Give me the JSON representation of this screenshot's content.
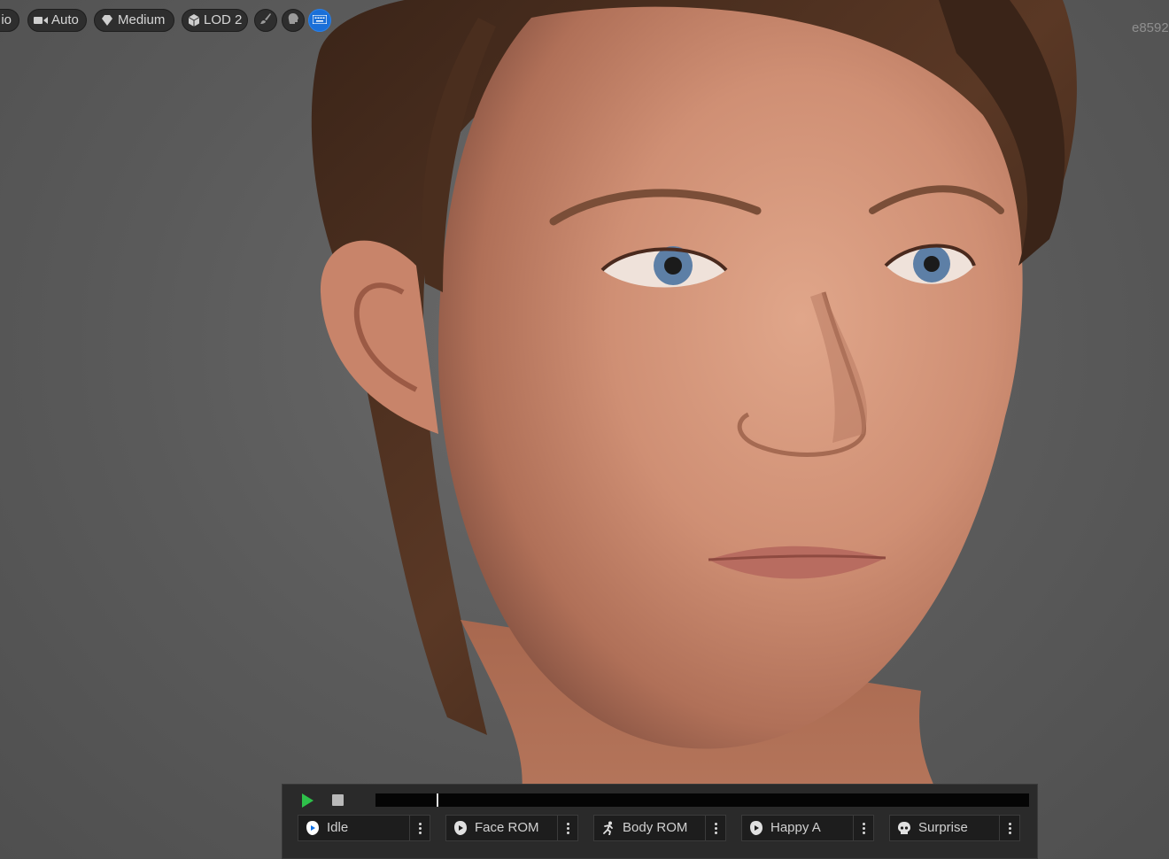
{
  "toolbar": {
    "cut_label": "io",
    "auto_label": "Auto",
    "medium_label": "Medium",
    "lod_label": "LOD 2",
    "icons": [
      "camera-icon",
      "diamond-icon",
      "cube-icon",
      "brush-icon",
      "head-icon",
      "keyboard-icon"
    ]
  },
  "corner_id": "e8592",
  "timeline": {
    "progress": 0.093
  },
  "animations": [
    {
      "label": "Idle",
      "icon": "face-play-icon",
      "active": true
    },
    {
      "label": "Face ROM",
      "icon": "face-play-icon",
      "active": false
    },
    {
      "label": "Body ROM",
      "icon": "running-figure-icon",
      "active": false
    },
    {
      "label": "Happy A",
      "icon": "face-play-icon",
      "active": false
    },
    {
      "label": "Surprise",
      "icon": "skull-icon",
      "active": false
    }
  ],
  "colors": {
    "accent": "#0f71e6",
    "play": "#2ec04a",
    "panel": "#2a2a2a"
  }
}
